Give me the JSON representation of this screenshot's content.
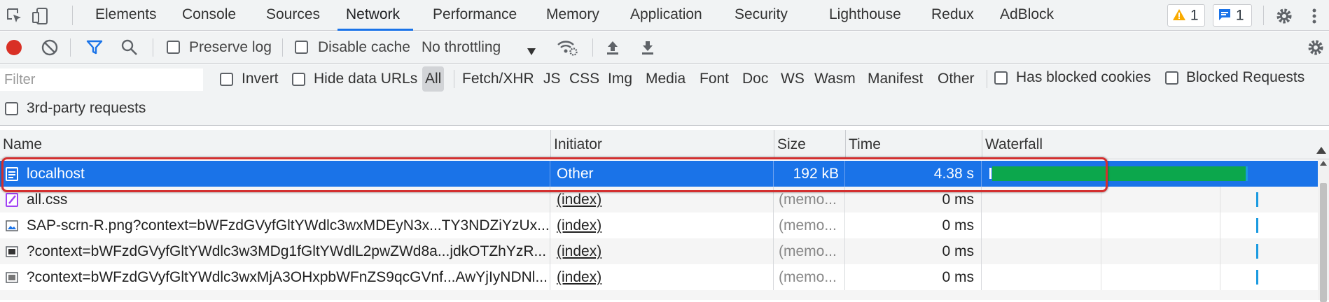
{
  "tabs": [
    {
      "label": "Elements"
    },
    {
      "label": "Console"
    },
    {
      "label": "Sources"
    },
    {
      "label": "Network",
      "active": true
    },
    {
      "label": "Performance"
    },
    {
      "label": "Memory"
    },
    {
      "label": "Application"
    },
    {
      "label": "Security"
    },
    {
      "label": "Lighthouse"
    },
    {
      "label": "Redux"
    },
    {
      "label": "AdBlock"
    }
  ],
  "badges": {
    "warnings": "1",
    "messages": "1"
  },
  "toolbar": {
    "preserve_log": "Preserve log",
    "disable_cache": "Disable cache",
    "throttling": "No throttling"
  },
  "filter": {
    "placeholder": "Filter",
    "invert": "Invert",
    "hide_data_urls": "Hide data URLs",
    "types": [
      "All",
      "Fetch/XHR",
      "JS",
      "CSS",
      "Img",
      "Media",
      "Font",
      "Doc",
      "WS",
      "Wasm",
      "Manifest",
      "Other"
    ],
    "has_blocked_cookies": "Has blocked cookies",
    "blocked_requests": "Blocked Requests",
    "third_party": "3rd-party requests"
  },
  "table": {
    "headers": {
      "name": "Name",
      "initiator": "Initiator",
      "size": "Size",
      "time": "Time",
      "waterfall": "Waterfall"
    },
    "rows": [
      {
        "name": "localhost",
        "initiator": "Other",
        "size": "192 kB",
        "time": "4.38 s",
        "icon": "document-icon"
      },
      {
        "name": "all.css",
        "initiator": "(index)",
        "size": "(memo...",
        "time": "0 ms",
        "icon": "css-file-icon"
      },
      {
        "name": "SAP-scrn-R.png?context=bWFzdGVyfGltYWdlc3wxMDEyN3x...TY3NDZiYzUx...",
        "initiator": "(index)",
        "size": "(memo...",
        "time": "0 ms",
        "icon": "image-file-icon"
      },
      {
        "name": "?context=bWFzdGVyfGltYWdlc3w3MDg1fGltYWdlL2pwZWd8a...jdkOTZhYzR...",
        "initiator": "(index)",
        "size": "(memo...",
        "time": "0 ms",
        "icon": "image-file-icon"
      },
      {
        "name": "?context=bWFzdGVyfGltYWdlc3wxMjA3OHxpbWFnZS9qcGVnf...AwYjIyNDNl...",
        "initiator": "(index)",
        "size": "(memo...",
        "time": "0 ms",
        "icon": "image-file-icon"
      }
    ]
  },
  "colors": {
    "accent": "#1a73e8",
    "record": "#d93025",
    "waterfall_bar": "#0ca74c",
    "highlight": "#d32f2f"
  }
}
